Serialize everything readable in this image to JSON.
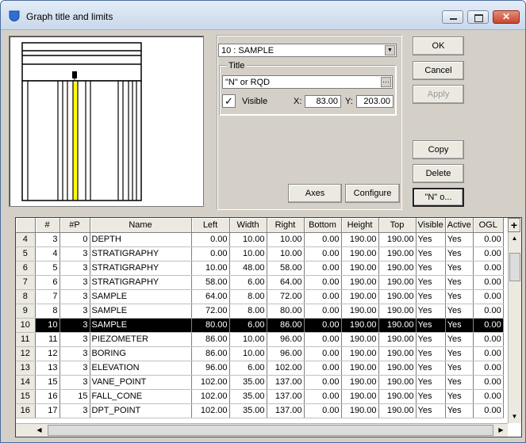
{
  "window": {
    "title": "Graph title and limits"
  },
  "series_combo": {
    "value": "10 : SAMPLE"
  },
  "title_group": {
    "legend": "Title",
    "text": "\"N\" or RQD",
    "visible_label": "Visible",
    "visible_checked": true,
    "x_label": "X:",
    "x_value": "83.00",
    "y_label": "Y:",
    "y_value": "203.00"
  },
  "buttons": {
    "ok": "OK",
    "cancel": "Cancel",
    "apply": "Apply",
    "copy": "Copy",
    "delete": "Delete",
    "font": "\"N\" o...",
    "axes": "Axes",
    "configure": "Configure"
  },
  "table": {
    "columns": [
      "#",
      "#P",
      "Name",
      "Left",
      "Width",
      "Right",
      "Bottom",
      "Height",
      "Top",
      "Visible",
      "Active",
      "OGL"
    ],
    "rows": [
      {
        "row": "4",
        "n": "3",
        "p": "0",
        "name": "DEPTH",
        "left": "0.00",
        "width": "10.00",
        "right": "10.00",
        "bottom": "0.00",
        "height": "190.00",
        "top": "190.00",
        "visible": "Yes",
        "active": "Yes",
        "ogl": "0.00"
      },
      {
        "row": "5",
        "n": "4",
        "p": "3",
        "name": "STRATIGRAPHY",
        "left": "0.00",
        "width": "10.00",
        "right": "10.00",
        "bottom": "0.00",
        "height": "190.00",
        "top": "190.00",
        "visible": "Yes",
        "active": "Yes",
        "ogl": "0.00"
      },
      {
        "row": "6",
        "n": "5",
        "p": "3",
        "name": "STRATIGRAPHY",
        "left": "10.00",
        "width": "48.00",
        "right": "58.00",
        "bottom": "0.00",
        "height": "190.00",
        "top": "190.00",
        "visible": "Yes",
        "active": "Yes",
        "ogl": "0.00"
      },
      {
        "row": "7",
        "n": "6",
        "p": "3",
        "name": "STRATIGRAPHY",
        "left": "58.00",
        "width": "6.00",
        "right": "64.00",
        "bottom": "0.00",
        "height": "190.00",
        "top": "190.00",
        "visible": "Yes",
        "active": "Yes",
        "ogl": "0.00"
      },
      {
        "row": "8",
        "n": "7",
        "p": "3",
        "name": "SAMPLE",
        "left": "64.00",
        "width": "8.00",
        "right": "72.00",
        "bottom": "0.00",
        "height": "190.00",
        "top": "190.00",
        "visible": "Yes",
        "active": "Yes",
        "ogl": "0.00"
      },
      {
        "row": "9",
        "n": "8",
        "p": "3",
        "name": "SAMPLE",
        "left": "72.00",
        "width": "8.00",
        "right": "80.00",
        "bottom": "0.00",
        "height": "190.00",
        "top": "190.00",
        "visible": "Yes",
        "active": "Yes",
        "ogl": "0.00"
      },
      {
        "row": "10",
        "n": "10",
        "p": "3",
        "name": "SAMPLE",
        "left": "80.00",
        "width": "6.00",
        "right": "86.00",
        "bottom": "0.00",
        "height": "190.00",
        "top": "190.00",
        "visible": "Yes",
        "active": "Yes",
        "ogl": "0.00",
        "selected": true
      },
      {
        "row": "11",
        "n": "11",
        "p": "3",
        "name": "PIEZOMETER",
        "left": "86.00",
        "width": "10.00",
        "right": "96.00",
        "bottom": "0.00",
        "height": "190.00",
        "top": "190.00",
        "visible": "Yes",
        "active": "Yes",
        "ogl": "0.00"
      },
      {
        "row": "12",
        "n": "12",
        "p": "3",
        "name": "BORING",
        "left": "86.00",
        "width": "10.00",
        "right": "96.00",
        "bottom": "0.00",
        "height": "190.00",
        "top": "190.00",
        "visible": "Yes",
        "active": "Yes",
        "ogl": "0.00"
      },
      {
        "row": "13",
        "n": "13",
        "p": "3",
        "name": "ELEVATION",
        "left": "96.00",
        "width": "6.00",
        "right": "102.00",
        "bottom": "0.00",
        "height": "190.00",
        "top": "190.00",
        "visible": "Yes",
        "active": "Yes",
        "ogl": "0.00"
      },
      {
        "row": "14",
        "n": "15",
        "p": "3",
        "name": "VANE_POINT",
        "left": "102.00",
        "width": "35.00",
        "right": "137.00",
        "bottom": "0.00",
        "height": "190.00",
        "top": "190.00",
        "visible": "Yes",
        "active": "Yes",
        "ogl": "0.00"
      },
      {
        "row": "15",
        "n": "16",
        "p": "15",
        "name": "FALL_CONE",
        "left": "102.00",
        "width": "35.00",
        "right": "137.00",
        "bottom": "0.00",
        "height": "190.00",
        "top": "190.00",
        "visible": "Yes",
        "active": "Yes",
        "ogl": "0.00"
      },
      {
        "row": "16",
        "n": "17",
        "p": "3",
        "name": "DPT_POINT",
        "left": "102.00",
        "width": "35.00",
        "right": "137.00",
        "bottom": "0.00",
        "height": "190.00",
        "top": "190.00",
        "visible": "Yes",
        "active": "Yes",
        "ogl": "0.00"
      }
    ]
  },
  "colors": {
    "highlight_column": "#ffff00",
    "selected_row_bg": "#000000",
    "title_accent": "#2f6fd0"
  },
  "icons": {
    "app": "shield-icon",
    "minimize": "minimize-icon",
    "maximize": "maximize-icon",
    "close": "close-icon",
    "dropdown": "chevron-down-icon",
    "ellipsis": "ellipsis-icon",
    "add_column": "plus-icon"
  }
}
